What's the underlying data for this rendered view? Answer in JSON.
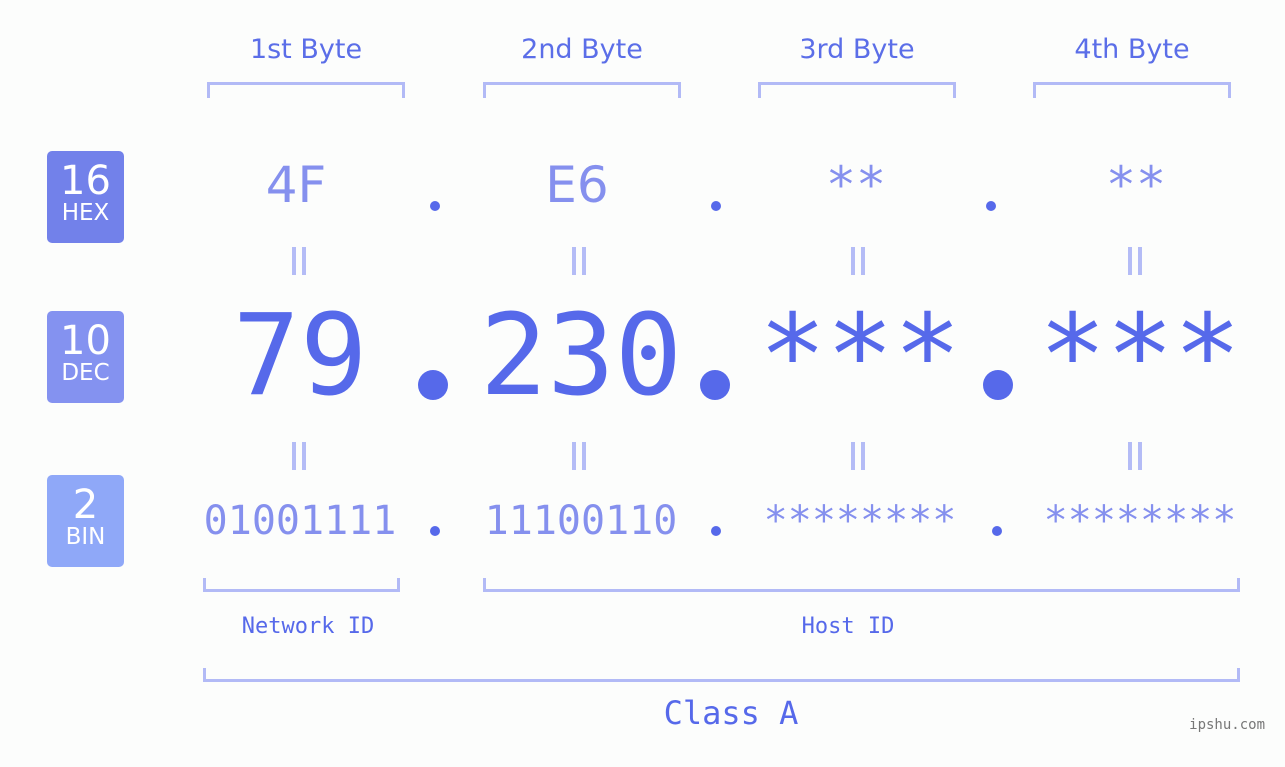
{
  "bytes": [
    {
      "header": "1st Byte",
      "hex": "4F",
      "dec": "79",
      "bin": "01001111"
    },
    {
      "header": "2nd Byte",
      "hex": "E6",
      "dec": "230",
      "bin": "11100110"
    },
    {
      "header": "3rd Byte",
      "hex": "**",
      "dec": "***",
      "bin": "********"
    },
    {
      "header": "4th Byte",
      "hex": "**",
      "dec": "***",
      "bin": "********"
    }
  ],
  "badges": {
    "hex": {
      "num": "16",
      "label": "HEX",
      "color": "#7281ea"
    },
    "dec": {
      "num": "10",
      "label": "DEC",
      "color": "#8492f0"
    },
    "bin": {
      "num": "2",
      "label": "BIN",
      "color": "#8fa8f8"
    }
  },
  "network_label": "Network ID",
  "host_label": "Host ID",
  "class_label": "Class A",
  "watermark": "ipshu.com",
  "colors": {
    "accent": "#5669ea",
    "light": "#8590ee",
    "bracket": "#b2baf6",
    "background": "#fcfdfc"
  }
}
